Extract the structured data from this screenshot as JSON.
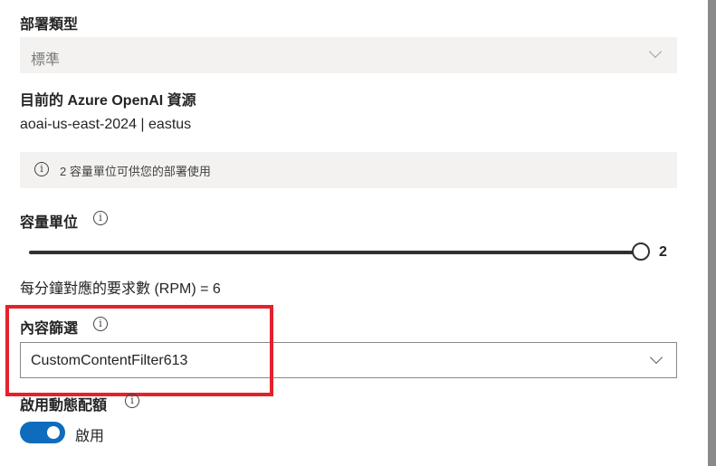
{
  "deployment_type": {
    "label": "部署類型",
    "value": "標準"
  },
  "resource": {
    "label": "目前的 Azure OpenAI 資源",
    "value": "aoai-us-east-2024 | eastus"
  },
  "info_message": "2 容量單位可供您的部署使用",
  "capacity": {
    "label": "容量單位",
    "value": 2,
    "value_text": "2",
    "fraction": 1.0,
    "rpm_text": "每分鐘對應的要求數 (RPM) = 6"
  },
  "content_filter": {
    "label": "內容篩選",
    "value": "CustomContentFilter613"
  },
  "dynamic_quota": {
    "label": "啟用動態配額",
    "enabled": true,
    "toggle_label": "啟用"
  },
  "colors": {
    "accent": "#0f6cbd",
    "highlight": "#e3222b"
  },
  "icons": [
    "info-icon",
    "chevron-down-icon"
  ]
}
